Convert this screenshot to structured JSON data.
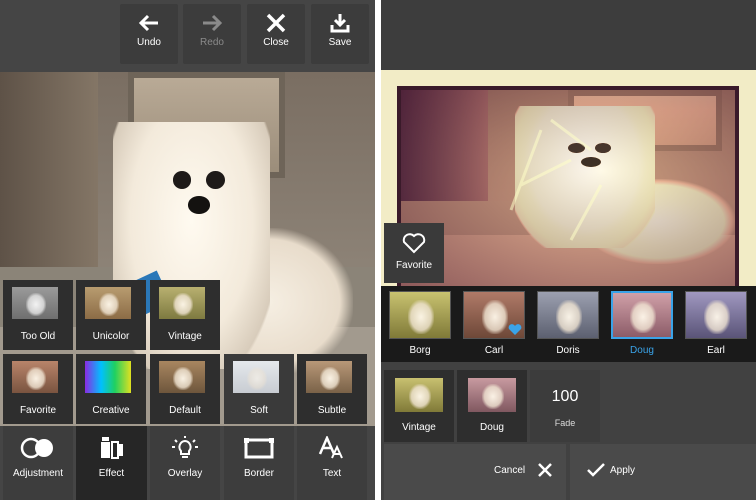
{
  "toolbar": {
    "undo_label": "Undo",
    "redo_label": "Redo",
    "close_label": "Close",
    "save_label": "Save"
  },
  "effect_tiles": [
    {
      "label": "Too Old",
      "icon": "too-old-thumbnail"
    },
    {
      "label": "Unicolor",
      "icon": "unicolor-thumbnail"
    },
    {
      "label": "Vintage",
      "icon": "vintage-thumbnail"
    },
    {
      "label": "Favorite",
      "icon": "favorite-thumbnail"
    },
    {
      "label": "Creative",
      "icon": "creative-thumbnail"
    },
    {
      "label": "Default",
      "icon": "default-thumbnail"
    },
    {
      "label": "Soft",
      "icon": "soft-thumbnail"
    },
    {
      "label": "Subtle",
      "icon": "subtle-thumbnail"
    }
  ],
  "bottom_nav": [
    {
      "label": "Adjustment",
      "icon": "adjustment-icon"
    },
    {
      "label": "Effect",
      "icon": "effect-icon",
      "selected": true
    },
    {
      "label": "Overlay",
      "icon": "overlay-icon"
    },
    {
      "label": "Border",
      "icon": "border-icon"
    },
    {
      "label": "Text",
      "icon": "text-icon"
    }
  ],
  "favorite_button": {
    "label": "Favorite",
    "icon": "heart-icon"
  },
  "filter_strip": [
    {
      "label": "Borg"
    },
    {
      "label": "Carl",
      "favorited": true
    },
    {
      "label": "Doris"
    },
    {
      "label": "Doug",
      "selected": true
    },
    {
      "label": "Earl"
    }
  ],
  "sub_tiles": [
    {
      "label": "Vintage"
    },
    {
      "label": "Doug"
    }
  ],
  "fade": {
    "value": "100",
    "label": "Fade"
  },
  "actions": {
    "cancel_label": "Cancel",
    "apply_label": "Apply"
  },
  "colors": {
    "selected_accent": "#3aa3e8",
    "panel_bg": "#2e2e2e",
    "canvas_bg": "#f2ecc6"
  }
}
